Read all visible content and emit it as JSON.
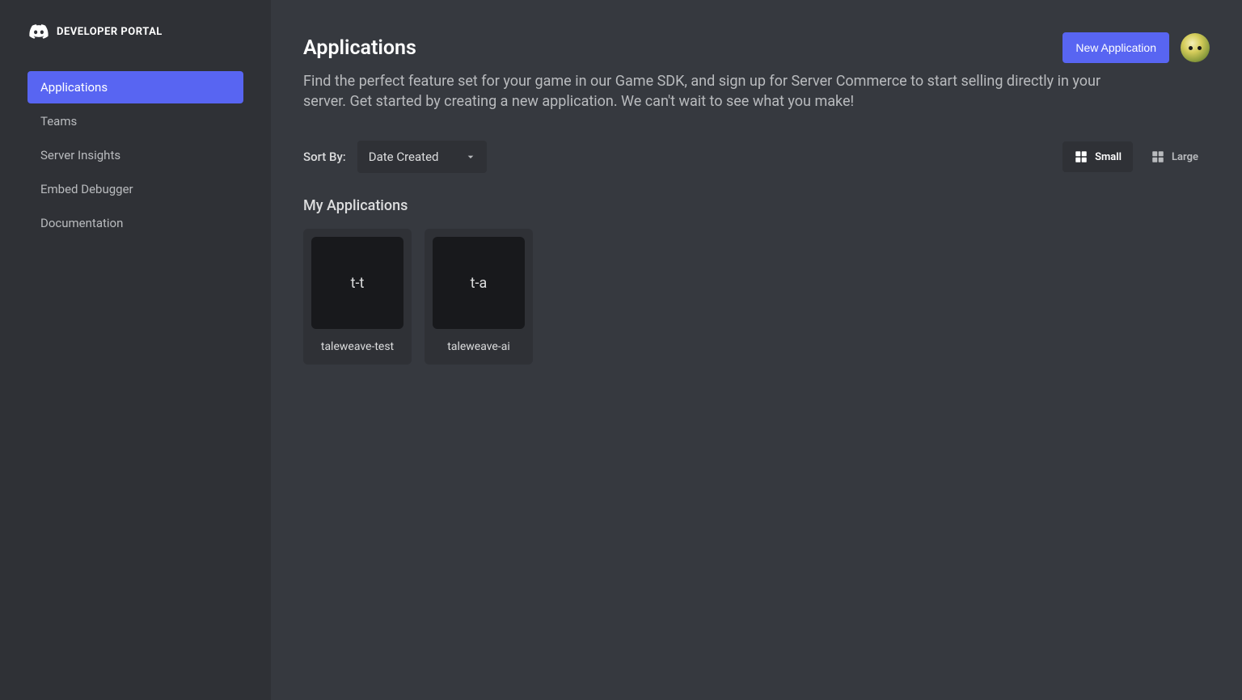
{
  "sidebar": {
    "title": "DEVELOPER PORTAL",
    "items": [
      {
        "label": "Applications",
        "active": true
      },
      {
        "label": "Teams",
        "active": false
      },
      {
        "label": "Server Insights",
        "active": false
      },
      {
        "label": "Embed Debugger",
        "active": false
      },
      {
        "label": "Documentation",
        "active": false
      }
    ]
  },
  "header": {
    "title": "Applications",
    "new_app_label": "New Application"
  },
  "description": "Find the perfect feature set for your game in our Game SDK, and sign up for Server Commerce to start selling directly in your server. Get started by creating a new application. We can't wait to see what you make!",
  "sort": {
    "label": "Sort By:",
    "value": "Date Created"
  },
  "view": {
    "small_label": "Small",
    "large_label": "Large",
    "active": "small"
  },
  "section_title": "My Applications",
  "apps": [
    {
      "abbr": "t-t",
      "name": "taleweave-test"
    },
    {
      "abbr": "t-a",
      "name": "taleweave-ai"
    }
  ]
}
